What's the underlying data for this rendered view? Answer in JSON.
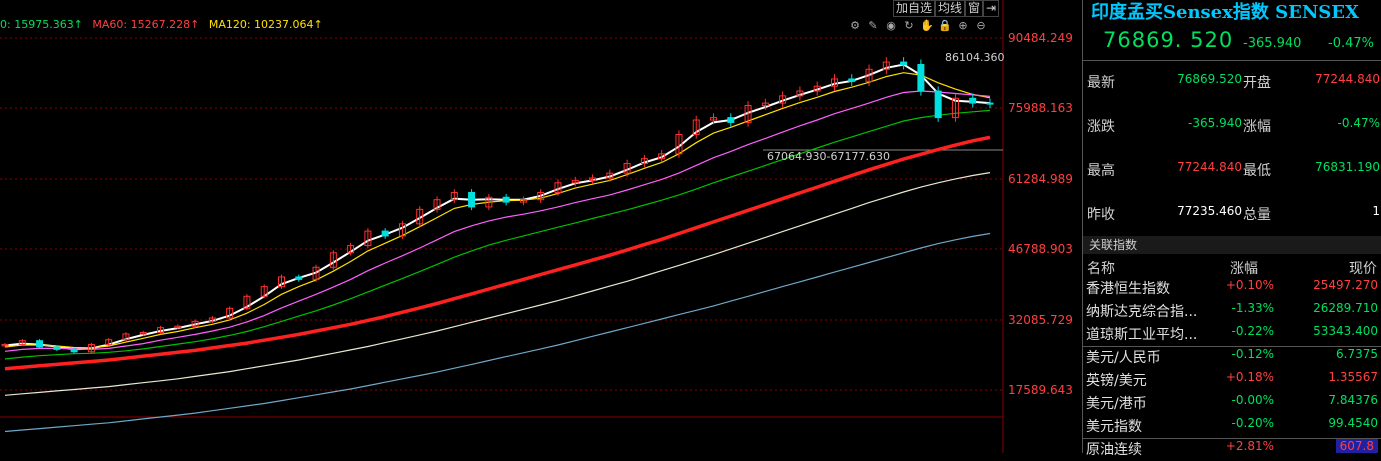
{
  "chart_data": {
    "type": "candlestick",
    "ma_legend": [
      {
        "label": "0: 15975.363↑",
        "color": "#00e060"
      },
      {
        "label": "MA60: 15267.228↑",
        "color": "#ff4040"
      },
      {
        "label": "MA120: 10237.064↑",
        "color": "#ffe000"
      }
    ],
    "y_ticks": [
      "90484.249",
      "75988.163",
      "61284.989",
      "46788.903",
      "32085.729",
      "17589.643"
    ],
    "y_tick_values": [
      90484.249,
      75988.163,
      61284.989,
      46788.903,
      32085.729,
      17589.643
    ],
    "annotation_high": "86104.360",
    "annotation_range": "67064.930-67177.630",
    "ylim": [
      10000,
      95000
    ],
    "series": [
      {
        "name": "close",
        "color": "#ff4040",
        "values": [
          27000,
          27800,
          26500,
          26000,
          25500,
          27000,
          28000,
          29200,
          29500,
          30500,
          30800,
          31800,
          32500,
          34500,
          37000,
          39000,
          41000,
          40500,
          43000,
          46000,
          47500,
          50500,
          49500,
          52000,
          55000,
          57000,
          58500,
          55500,
          57500,
          56500,
          57000,
          58500,
          60500,
          61000,
          61500,
          62500,
          64500,
          65500,
          66500,
          70500,
          73500,
          74000,
          73000,
          76500,
          77000,
          78500,
          79500,
          80500,
          82000,
          81500,
          84000,
          85500,
          85000,
          79500,
          74000,
          78000,
          77000,
          76869
        ]
      },
      {
        "name": "ma-white",
        "color": "#ffffff",
        "values": [
          26800,
          27200,
          27000,
          26600,
          26000,
          26200,
          27000,
          28100,
          29000,
          29800,
          30400,
          31200,
          31900,
          33000,
          34800,
          37000,
          39500,
          40800,
          41900,
          44000,
          46200,
          48500,
          49800,
          51200,
          53200,
          55300,
          57200,
          57000,
          57100,
          57000,
          57000,
          57800,
          59200,
          60400,
          61000,
          61800,
          63200,
          64700,
          65800,
          68000,
          71000,
          73000,
          73500,
          75000,
          76200,
          77500,
          78700,
          79800,
          81000,
          81600,
          82800,
          84300,
          85000,
          82800,
          79000,
          77500,
          77300,
          77000
        ]
      },
      {
        "name": "ma-yellow",
        "color": "#ffe000",
        "values": [
          26500,
          26900,
          26900,
          26700,
          26400,
          26300,
          26700,
          27500,
          28300,
          29100,
          29700,
          30500,
          31200,
          32100,
          33500,
          35300,
          37400,
          39000,
          40400,
          42200,
          44200,
          46400,
          48000,
          49600,
          51400,
          53300,
          55200,
          56000,
          56500,
          56800,
          56900,
          57300,
          58300,
          59400,
          60200,
          61000,
          62200,
          63500,
          64700,
          66500,
          68800,
          70800,
          72000,
          73300,
          74600,
          75900,
          77100,
          78200,
          79400,
          80300,
          81300,
          82500,
          83300,
          82800,
          81200,
          79900,
          78800,
          78100
        ]
      },
      {
        "name": "ma-magenta",
        "color": "#ff60ff",
        "values": [
          25600,
          26000,
          26200,
          26200,
          26100,
          26000,
          26200,
          26700,
          27200,
          27900,
          28500,
          29100,
          29800,
          30600,
          31700,
          33000,
          34600,
          36000,
          37400,
          38900,
          40500,
          42300,
          43900,
          45400,
          47000,
          48700,
          50400,
          51600,
          52600,
          53400,
          54000,
          54700,
          55500,
          56400,
          57200,
          58000,
          59000,
          60100,
          61200,
          62500,
          64100,
          65700,
          67000,
          68400,
          69700,
          71000,
          72300,
          73500,
          74800,
          75900,
          77000,
          78200,
          79200,
          79500,
          79300,
          79000,
          78700,
          78400
        ]
      },
      {
        "name": "ma-green",
        "color": "#00c000",
        "values": [
          24000,
          24400,
          24700,
          24900,
          25100,
          25200,
          25400,
          25700,
          26100,
          26600,
          27100,
          27600,
          28200,
          28900,
          29700,
          30700,
          31800,
          32900,
          34000,
          35200,
          36500,
          37900,
          39300,
          40700,
          42100,
          43600,
          45100,
          46400,
          47600,
          48600,
          49500,
          50400,
          51300,
          52200,
          53100,
          54000,
          54900,
          55900,
          56900,
          58000,
          59200,
          60500,
          61700,
          62900,
          64100,
          65300,
          66500,
          67700,
          68900,
          70000,
          71100,
          72200,
          73300,
          74000,
          74500,
          74900,
          75200,
          75500
        ]
      },
      {
        "name": "ma-thickred",
        "color": "#ff2020",
        "values": [
          22000,
          22300,
          22600,
          22900,
          23200,
          23500,
          23800,
          24200,
          24600,
          25000,
          25400,
          25800,
          26300,
          26800,
          27300,
          27900,
          28500,
          29100,
          29800,
          30500,
          31200,
          32000,
          32800,
          33700,
          34600,
          35500,
          36500,
          37500,
          38500,
          39500,
          40500,
          41500,
          42500,
          43500,
          44500,
          45500,
          46600,
          47700,
          48800,
          50000,
          51200,
          52400,
          53600,
          54800,
          56000,
          57200,
          58400,
          59600,
          60800,
          62000,
          63200,
          64300,
          65400,
          66400,
          67400,
          68300,
          69200,
          69900
        ]
      },
      {
        "name": "ma-offwhite",
        "color": "#e8e8d0",
        "values": [
          16500,
          16800,
          17100,
          17400,
          17700,
          18000,
          18300,
          18700,
          19100,
          19500,
          19900,
          20400,
          20900,
          21400,
          22000,
          22600,
          23200,
          23800,
          24500,
          25200,
          25900,
          26600,
          27400,
          28200,
          29000,
          29800,
          30700,
          31600,
          32500,
          33400,
          34300,
          35200,
          36100,
          37100,
          38100,
          39100,
          40100,
          41200,
          42300,
          43400,
          44500,
          45600,
          46800,
          48000,
          49200,
          50400,
          51600,
          52800,
          54000,
          55200,
          56400,
          57500,
          58600,
          59600,
          60500,
          61300,
          62000,
          62600
        ]
      },
      {
        "name": "ma-blue",
        "color": "#6ea8c8",
        "values": [
          9000,
          9300,
          9600,
          9900,
          10200,
          10500,
          10800,
          11200,
          11600,
          12000,
          12400,
          12800,
          13300,
          13800,
          14300,
          14800,
          15400,
          16000,
          16600,
          17200,
          17800,
          18500,
          19200,
          19900,
          20600,
          21300,
          22100,
          22900,
          23700,
          24500,
          25300,
          26100,
          26900,
          27800,
          28700,
          29600,
          30500,
          31400,
          32300,
          33200,
          34100,
          35000,
          36000,
          37000,
          38000,
          39000,
          40000,
          41000,
          42000,
          43000,
          44000,
          45000,
          46000,
          47000,
          47900,
          48700,
          49400,
          50000
        ]
      }
    ]
  },
  "toolbar": {
    "add_fav": "加自选",
    "ma": "均线",
    "window": "窗"
  },
  "panel": {
    "title": "印度孟买Sensex指数 SENSEX",
    "price": "76869. 520",
    "change": "-365.940",
    "change_pct": "-0.47%",
    "rows": [
      {
        "l1": "最新",
        "v1": "76869.520",
        "l2": "开盘",
        "v2": "77244.840",
        "v1c": "green",
        "v2c": "red"
      },
      {
        "l1": "涨跌",
        "v1": "-365.940",
        "l2": "涨幅",
        "v2": "-0.47%",
        "v1c": "green",
        "v2c": "green"
      },
      {
        "l1": "最高",
        "v1": "77244.840",
        "l2": "最低",
        "v2": "76831.190",
        "v1c": "red",
        "v2c": "green"
      },
      {
        "l1": "昨收",
        "v1": "77235.460",
        "l2": "总量",
        "v2": "1",
        "v1c": "white",
        "v2c": "white"
      }
    ],
    "related_title": "关联指数",
    "col_name": "名称",
    "col_pct": "涨幅",
    "col_price": "现价",
    "indices": [
      {
        "name": "香港恒生指数",
        "pct": "+0.10%",
        "price": "25497.270",
        "pc": "red",
        "cc": "red"
      },
      {
        "name": "纳斯达克综合指...",
        "pct": "-1.33%",
        "price": "26289.710",
        "pc": "green",
        "cc": "green"
      },
      {
        "name": "道琼斯工业平均...",
        "pct": "-0.22%",
        "price": "53343.400",
        "pc": "green",
        "cc": "green"
      },
      {
        "name": "美元/人民币",
        "pct": "-0.12%",
        "price": "6.7375",
        "pc": "green",
        "cc": "green"
      },
      {
        "name": "英镑/美元",
        "pct": "+0.18%",
        "price": "1.35567",
        "pc": "red",
        "cc": "red"
      },
      {
        "name": "美元/港币",
        "pct": "-0.00%",
        "price": "7.84376",
        "pc": "green",
        "cc": "green"
      },
      {
        "name": "美元指数",
        "pct": "-0.20%",
        "price": "99.4540",
        "pc": "green",
        "cc": "green"
      },
      {
        "name": "原油连续",
        "pct": "+2.81%",
        "price": "607.8",
        "pc": "red",
        "cc": "red"
      }
    ]
  }
}
